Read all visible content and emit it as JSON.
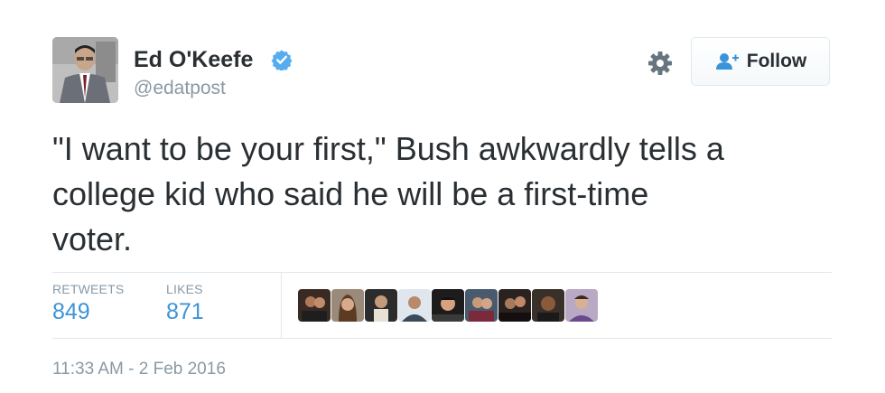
{
  "author": {
    "display_name": "Ed O'Keefe",
    "screen_name": "@edatpost",
    "verified": true,
    "avatar_icon": "profile-photo"
  },
  "actions": {
    "settings_icon": "gear-icon",
    "follow_label": "Follow",
    "follow_icon": "add-user-icon"
  },
  "tweet": {
    "lines": [
      "\"I want to be your first,\" Bush awkwardly tells a",
      "college kid who said he will be a first-time",
      "voter."
    ]
  },
  "stats": {
    "retweets_label": "RETWEETS",
    "retweets_value": "849",
    "likes_label": "LIKES",
    "likes_value": "871"
  },
  "likers": [
    {
      "name": "liker-avatar-1"
    },
    {
      "name": "liker-avatar-2"
    },
    {
      "name": "liker-avatar-3"
    },
    {
      "name": "liker-avatar-4"
    },
    {
      "name": "liker-avatar-5"
    },
    {
      "name": "liker-avatar-6"
    },
    {
      "name": "liker-avatar-7"
    },
    {
      "name": "liker-avatar-8"
    },
    {
      "name": "liker-avatar-9"
    }
  ],
  "timestamp": "11:33 AM - 2 Feb 2016",
  "colors": {
    "link_blue": "#3b94d9",
    "verified_blue": "#55acee",
    "muted_gray": "#8899a6",
    "text_dark": "#292f33"
  }
}
